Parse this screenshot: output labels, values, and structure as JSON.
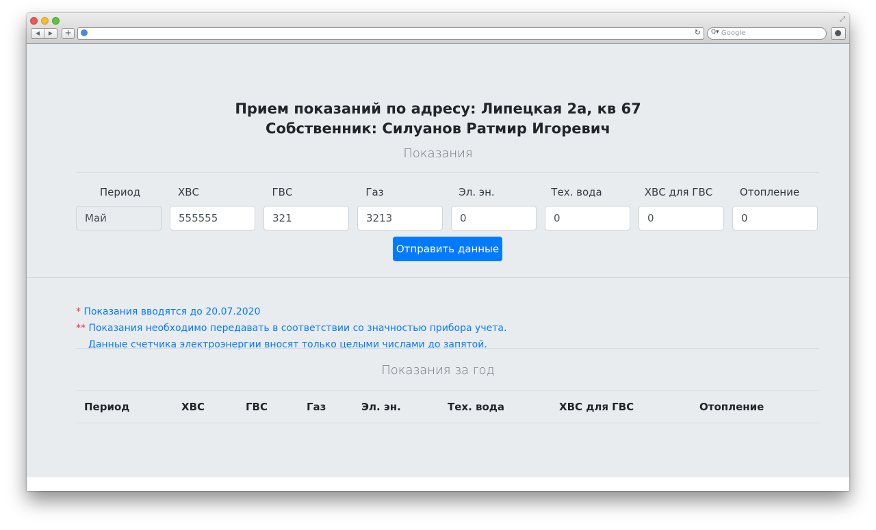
{
  "browser": {
    "search_placeholder": "Google",
    "back_glyph": "◀",
    "forward_glyph": "▶",
    "new_tab_glyph": "+",
    "reload_glyph": "↻",
    "search_glyph": "Q▾",
    "fullscreen_glyph": "⤢"
  },
  "header": {
    "address_line": "Прием показаний по адресу: Липецкая 2а, кв 67",
    "owner_line": "Собственник: Силуанов Ратмир Игоревич"
  },
  "readings_form": {
    "section_title": "Показания",
    "columns": [
      "Период",
      "ХВС",
      "ГВС",
      "Газ",
      "Эл. эн.",
      "Тех. вода",
      "ХВС для ГВС",
      "Отопление"
    ],
    "values": [
      "Май",
      "555555",
      "321",
      "3213",
      "0",
      "0",
      "0",
      "0"
    ],
    "submit_label": "Отправить данные"
  },
  "notes": {
    "note1_mark": "*",
    "note1_text": " Показания вводятся до 20.07.2020",
    "note2_mark": "**",
    "note2_text": " Показания необходимо передавать в соответствии со значностью прибора учета.",
    "note3_text": "Данные счетчика электроэнергии вносят только целыми числами до запятой."
  },
  "year_table": {
    "section_title": "Показания за год",
    "headers": [
      "Период",
      "ХВС",
      "ГВС",
      "Газ",
      "Эл. эн.",
      "Тех. вода",
      "ХВС для ГВС",
      "Отопление"
    ]
  }
}
